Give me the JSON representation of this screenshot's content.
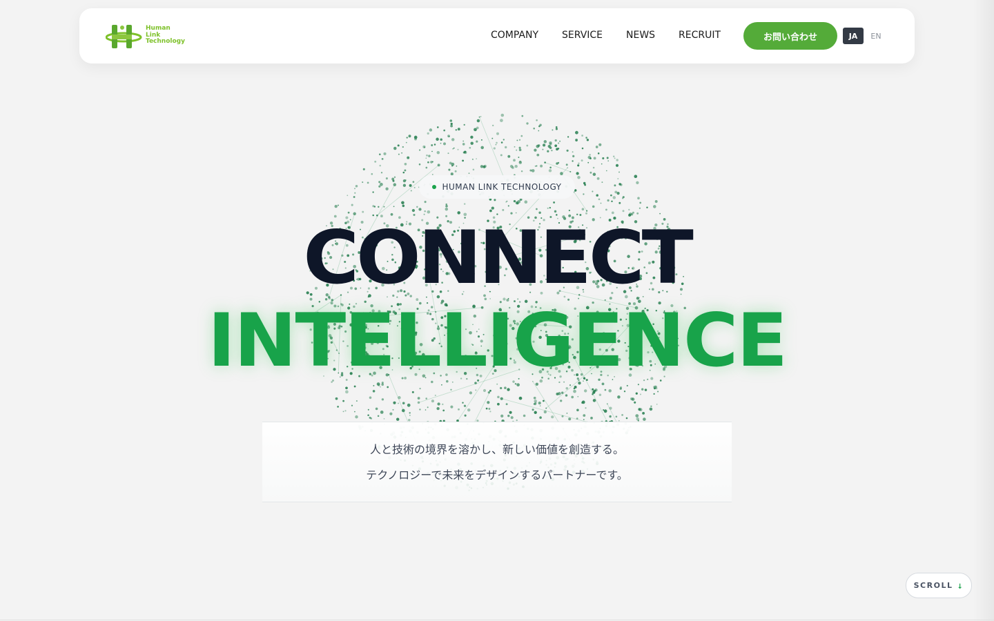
{
  "header": {
    "logo": {
      "lines": [
        "Human",
        "Link",
        "Technology"
      ],
      "accent_color": "#7ec12a"
    },
    "nav": [
      {
        "label": "COMPANY"
      },
      {
        "label": "SERVICE"
      },
      {
        "label": "NEWS"
      },
      {
        "label": "RECRUIT"
      }
    ],
    "contact_label": "お問い合わせ",
    "languages": {
      "ja": "JA",
      "en": "EN",
      "active": "JA"
    }
  },
  "hero": {
    "badge": "HUMAN LINK TECHNOLOGY",
    "headline_line1": "CONNECT",
    "headline_line2": "INTELLIGENCE",
    "tagline_line1": "人と技術の境界を溶かし、新しい価値を創造する。",
    "tagline_line2": "テクノロジーで未来をデザインするパートナーです。"
  },
  "scroll_label": "SCROLL",
  "colors": {
    "brand_green": "#18a34a",
    "button_green": "#54ab39",
    "dark_text": "#0e1628",
    "background": "#f3f3f3"
  },
  "icons": [
    "logo-mark-icon",
    "badge-dot-icon",
    "scroll-arrow-icon",
    "particle-sphere"
  ]
}
